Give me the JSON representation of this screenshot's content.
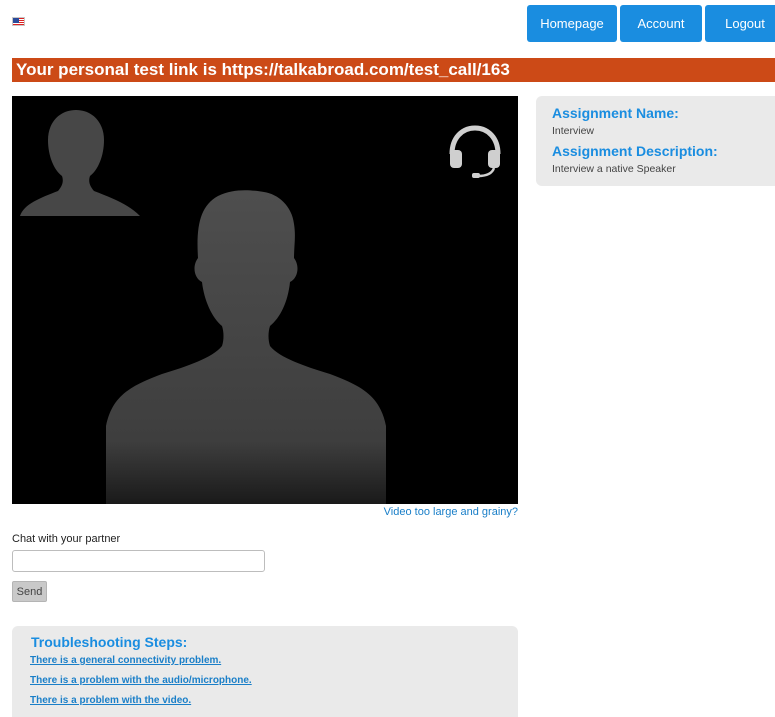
{
  "header": {
    "flag_icon": "us-flag-icon",
    "nav": {
      "homepage": "Homepage",
      "account": "Account",
      "logout": "Logout"
    }
  },
  "banner": {
    "text": "Your personal test link is https://talkabroad.com/test_call/163"
  },
  "video": {
    "headset_icon": "headset-icon",
    "link": "Video too large and grainy?"
  },
  "chat": {
    "label": "Chat with your partner",
    "input_value": "",
    "send_label": "Send"
  },
  "troubleshooting": {
    "title": "Troubleshooting Steps:",
    "links": [
      "There is a general connectivity problem.",
      "There is a problem with the audio/microphone.",
      "There is a problem with the video."
    ]
  },
  "assignment": {
    "name_label": "Assignment Name:",
    "name_value": "Interview",
    "desc_label": "Assignment Description:",
    "desc_value": "Interview a native Speaker"
  },
  "colors": {
    "accent": "#1a8de0",
    "banner": "#cc4a17"
  }
}
